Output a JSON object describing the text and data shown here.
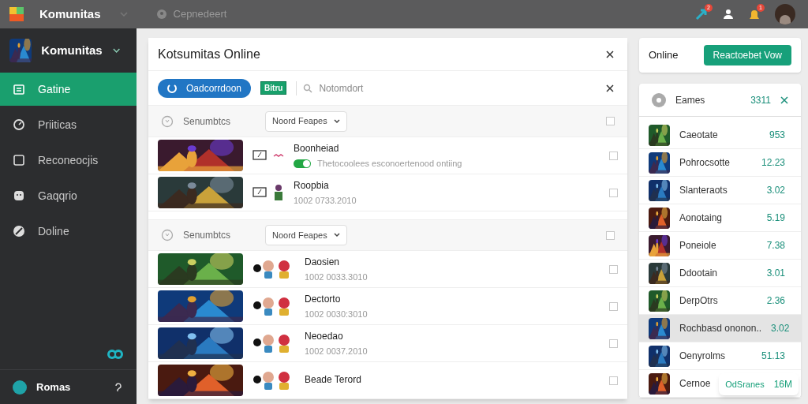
{
  "topbar": {
    "app_name": "Komunitas",
    "search_placeholder": "Cepnedeert",
    "badges": [
      "2",
      "1"
    ]
  },
  "sidebar": {
    "header": "Komunitas",
    "items": [
      {
        "label": "Gatine",
        "selected": true
      },
      {
        "label": "Priiticas",
        "selected": false
      },
      {
        "label": "Reconeocjis",
        "selected": false
      },
      {
        "label": "Gaqqrio",
        "selected": false
      },
      {
        "label": "Doline",
        "selected": false
      }
    ],
    "footer": "Romas"
  },
  "panel": {
    "title": "Kotsumitas Online",
    "pill": "Oadcorrdoon",
    "tag": "Bitru",
    "search_placeholder": "Notomdort",
    "groups": [
      {
        "label": "Senumbtcs",
        "dropdown": "Noord Feapes",
        "checked": false,
        "rows": [
          {
            "kind": "switch",
            "title": "Boonheiad",
            "subtitle": "Thetocoolees esconoertenood ontiing",
            "on": true,
            "checked": false
          },
          {
            "kind": "plain",
            "title": "Roopbia",
            "subtitle": "1002 0733.2010",
            "checked": false
          }
        ]
      },
      {
        "label": "Senumbtcs",
        "dropdown": "Noord Feapes",
        "checked": false,
        "rows": [
          {
            "kind": "figures",
            "title": "Daosien",
            "subtitle": "1002 0033.3010",
            "checked": false
          },
          {
            "kind": "figures",
            "title": "Dectorto",
            "subtitle": "1002 0030:3010",
            "checked": false
          },
          {
            "kind": "figures",
            "title": "Neoedao",
            "subtitle": "1002 0037.2010",
            "checked": false
          },
          {
            "kind": "figures",
            "title": "Beade Terord",
            "checked": false
          }
        ]
      }
    ]
  },
  "right": {
    "label": "Online",
    "button": "Reactoebet Vow",
    "list_title": "Eames",
    "count": "3311",
    "items": [
      {
        "name": "Caeotate",
        "value": "953",
        "selected": false
      },
      {
        "name": "Pohrocsotte",
        "value": "12.23",
        "selected": false
      },
      {
        "name": "Slanteraots",
        "value": "3.02",
        "selected": false
      },
      {
        "name": "Aonotaing",
        "value": "5.19",
        "selected": false
      },
      {
        "name": "Poneiole",
        "value": "7.38",
        "selected": false
      },
      {
        "name": "Ddootain",
        "value": "3.01",
        "selected": false
      },
      {
        "name": "DerpOtrs",
        "value": "2.36",
        "selected": false
      },
      {
        "name": "Rochbasd ononon..",
        "value": "3.02",
        "selected": true
      },
      {
        "name": "Oenyrolms",
        "value": "51.13",
        "selected": false
      },
      {
        "name": "Cernoe",
        "selected": false
      }
    ],
    "toast": {
      "label": "OdSranes",
      "value": "16M"
    }
  }
}
